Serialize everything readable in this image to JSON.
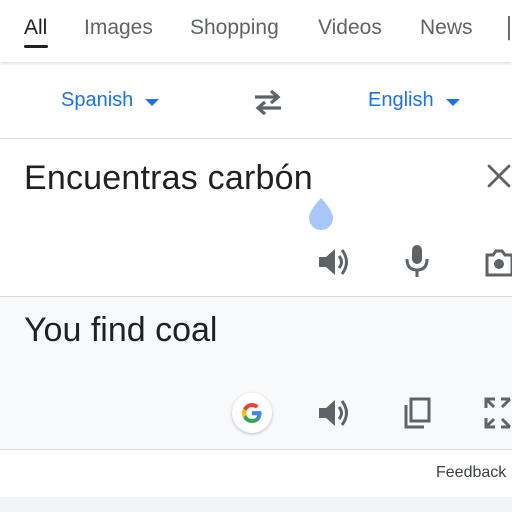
{
  "tabs": [
    {
      "label": "All",
      "active": true
    },
    {
      "label": "Images"
    },
    {
      "label": "Shopping"
    },
    {
      "label": "Videos"
    },
    {
      "label": "News"
    }
  ],
  "languages": {
    "source": "Spanish",
    "target": "English"
  },
  "source_panel": {
    "text": "Encuentras carbón"
  },
  "target_panel": {
    "text": "You find coal"
  },
  "footer": {
    "feedback": "Feedback"
  },
  "colors": {
    "accent": "#1a73e8",
    "icon": "#5f6368",
    "text": "#202124"
  },
  "icons": [
    "clear-icon",
    "speaker-icon",
    "microphone-icon",
    "camera-icon",
    "google-icon",
    "copy-icon",
    "fullscreen-icon",
    "swap-icon"
  ]
}
